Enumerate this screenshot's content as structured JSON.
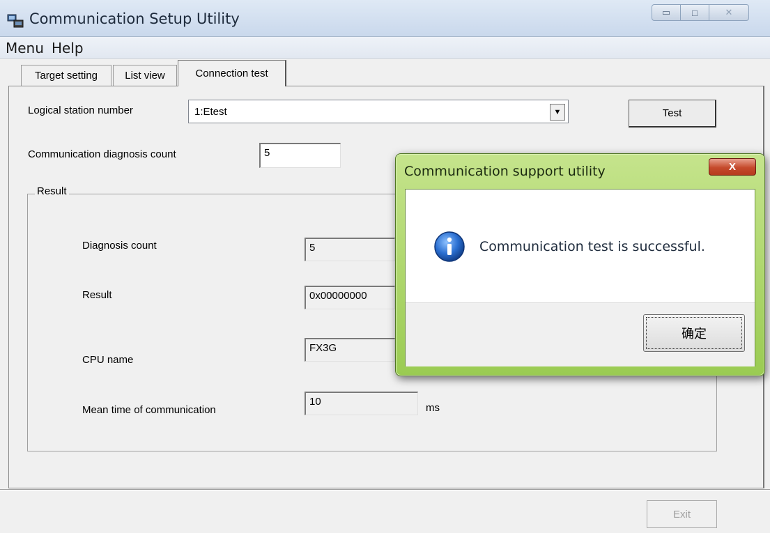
{
  "window": {
    "title": "Communication Setup Utility",
    "icon": "computer-network-icon",
    "controls": {
      "minimize": "minimize-icon",
      "maximize": "maximize-icon",
      "close": "close-icon"
    }
  },
  "menubar": {
    "items": [
      "Menu",
      "Help"
    ]
  },
  "tabs": [
    {
      "label": "Target setting",
      "active": false
    },
    {
      "label": "List view",
      "active": false
    },
    {
      "label": "Connection test",
      "active": true
    }
  ],
  "connection_test": {
    "logical_station_label": "Logical station number",
    "logical_station_value": "1:Etest",
    "test_button": "Test",
    "diag_count_label": "Communication diagnosis count",
    "diag_count_value": "5",
    "result_group": {
      "legend": "Result",
      "fields": [
        {
          "label": "Diagnosis count",
          "value": "5"
        },
        {
          "label": "Result",
          "value": "0x00000000"
        },
        {
          "label": "CPU name",
          "value": "FX3G"
        },
        {
          "label": "Mean time of communication",
          "value": "10",
          "unit": "ms"
        }
      ]
    }
  },
  "footer": {
    "exit_button": "Exit",
    "exit_enabled": false
  },
  "dialog": {
    "title": "Communication support utility",
    "close_icon": "X",
    "icon": "info-icon",
    "message": "Communication test is successful.",
    "ok_button": "确定"
  },
  "colors": {
    "window_bg": "#f0f0f0",
    "dialog_frame": "#a7d35f",
    "dialog_close": "#c54a2c",
    "info_icon": "#1f5fbf"
  }
}
